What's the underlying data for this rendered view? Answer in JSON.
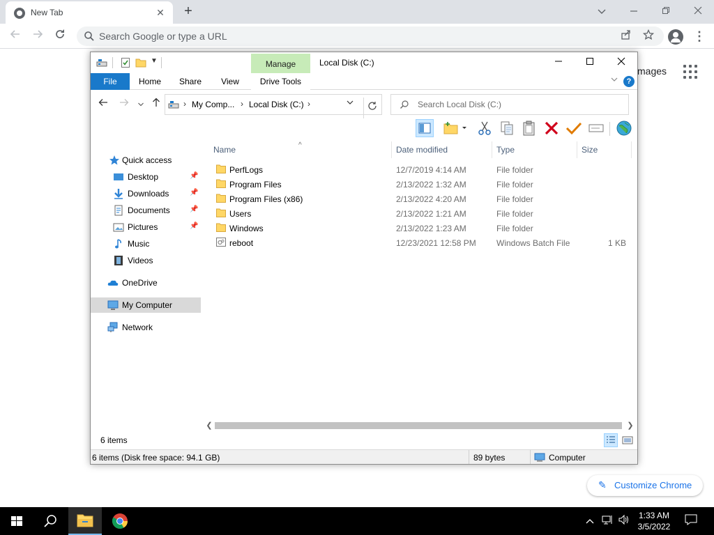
{
  "browser": {
    "tab_title": "New Tab",
    "tab_close": "✕",
    "new_tab": "+",
    "omnibox_placeholder": "Search Google or type a URL",
    "ntp_images_label": "mages",
    "customize_label": "Customize Chrome"
  },
  "explorer": {
    "title": "Local Disk (C:)",
    "contextual_tab": "Manage",
    "ribbon_tabs": [
      "File",
      "Home",
      "Share",
      "View",
      "Drive Tools"
    ],
    "breadcrumb": [
      "My Comp...",
      "Local Disk (C:)"
    ],
    "search_placeholder": "Search Local Disk (C:)",
    "nav": {
      "quick_access": "Quick access",
      "desktop": "Desktop",
      "downloads": "Downloads",
      "documents": "Documents",
      "pictures": "Pictures",
      "music": "Music",
      "videos": "Videos",
      "onedrive": "OneDrive",
      "my_computer": "My Computer",
      "network": "Network"
    },
    "columns": [
      "Name",
      "Date modified",
      "Type",
      "Size"
    ],
    "rows": [
      {
        "name": "PerfLogs",
        "date": "12/7/2019 4:14 AM",
        "type": "File folder",
        "size": ""
      },
      {
        "name": "Program Files",
        "date": "2/13/2022 1:32 AM",
        "type": "File folder",
        "size": ""
      },
      {
        "name": "Program Files (x86)",
        "date": "2/13/2022 4:20 AM",
        "type": "File folder",
        "size": ""
      },
      {
        "name": "Users",
        "date": "2/13/2022 1:21 AM",
        "type": "File folder",
        "size": ""
      },
      {
        "name": "Windows",
        "date": "2/13/2022 1:23 AM",
        "type": "File folder",
        "size": ""
      },
      {
        "name": "reboot",
        "date": "12/23/2021 12:58 PM",
        "type": "Windows Batch File",
        "size": "1 KB"
      }
    ],
    "item_count": "6 items",
    "status": {
      "summary": "6 items (Disk free space: 94.1 GB)",
      "size": "89 bytes",
      "location": "Computer"
    }
  },
  "taskbar": {
    "time": "1:33 AM",
    "date": "3/5/2022"
  },
  "colors": {
    "accent": "#1979ca",
    "manage_tab": "#c7ebb8",
    "folder": "#ffd766",
    "delete_red": "#d0021b",
    "check_orange": "#e07b00"
  }
}
